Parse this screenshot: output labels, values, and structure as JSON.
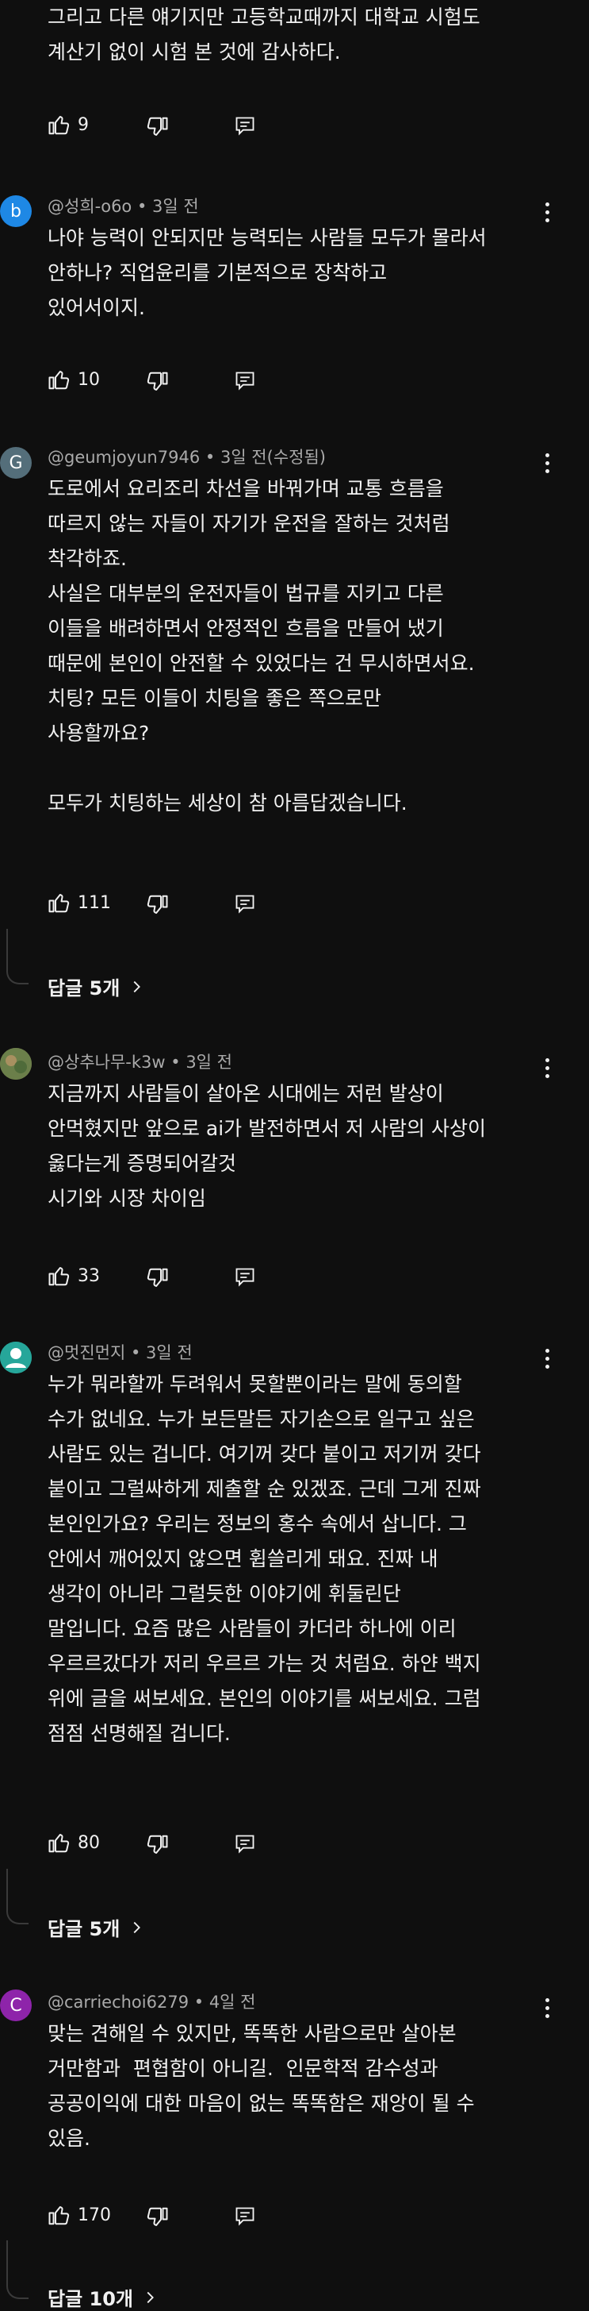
{
  "top_comment": {
    "lines": "그리고 다른 얘기지만 고등학교때까지 대학교 시험도\n계산기 없이 시험 본 것에 감사하다.",
    "likes": "9"
  },
  "comments": [
    {
      "avatar_letter": "b",
      "avatar_color": "#1e88e5",
      "author": "@성희-o6o",
      "time": "3일 전",
      "text": "나야 능력이 안되지만 능력되는 사람들 모두가 몰라서\n안하나? 직업윤리를 기본적으로 장착하고\n있어서이지.",
      "likes": "10"
    },
    {
      "avatar_letter": "G",
      "avatar_color": "#546e7a",
      "author": "@geumjoyun7946",
      "time": "3일 전(수정됨)",
      "text": "도로에서 요리조리 차선을 바꿔가며 교통 흐름을\n따르지 않는 자들이 자기가 운전을 잘하는 것처럼\n착각하죠.\n사실은 대부분의 운전자들이 법규를 지키고 다른\n이들을 배려하면서 안정적인 흐름을 만들어 냈기\n때문에 본인이 안전할 수 있었다는 건 무시하면서요.\n치팅? 모든 이들이 치팅을 좋은 쪽으로만\n사용할까요?\n\n모두가 치팅하는 세상이 참 아름답겠습니다.",
      "likes": "111",
      "replies": "답글 5개"
    },
    {
      "avatar_letter": "",
      "avatar_color": "#8a7a55",
      "author": "@상추나무-k3w",
      "time": "3일 전",
      "text": "지금까지 사람들이 살아온 시대에는 저런 발상이\n안먹혔지만 앞으로 ai가 발전하면서 저 사람의 사상이\n옳다는게 증명되어갈것\n시기와 시장 차이임",
      "likes": "33"
    },
    {
      "avatar_letter": "",
      "avatar_color": "#26a69a",
      "author": "@멋진먼지",
      "time": "3일 전",
      "text": "누가 뭐라할까 두려워서 못할뿐이라는 말에 동의할\n수가 없네요. 누가 보든말든 자기손으로 일구고 싶은\n사람도 있는 겁니다. 여기꺼 갖다 붙이고 저기꺼 갖다\n붙이고 그럴싸하게 제출할 순 있겠죠. 근데 그게 진짜\n본인인가요? 우리는 정보의 홍수 속에서 삽니다. 그\n안에서 깨어있지 않으면 휩쓸리게 돼요. 진짜 내\n생각이 아니라 그럴듯한 이야기에 휘둘린단\n말입니다. 요즘 많은 사람들이 카더라 하나에 이리\n우르르갔다가 저리 우르르 가는 것 처럼요. 하얀 백지\n위에 글을 써보세요. 본인의 이야기를 써보세요. 그럼\n점점 선명해질 겁니다.",
      "likes": "80",
      "replies": "답글 5개"
    },
    {
      "avatar_letter": "C",
      "avatar_color": "#8e24aa",
      "author": "@carriechoi6279",
      "time": "4일 전",
      "text": "맞는 견해일 수 있지만, 똑똑한 사람으로만 살아본\n거만함과  편협함이 아니길.  인문학적 감수성과\n공공이익에 대한 마음이 없는 똑똑함은 재앙이 될 수\n있음.",
      "likes": "170",
      "replies": "답글 10개"
    }
  ]
}
